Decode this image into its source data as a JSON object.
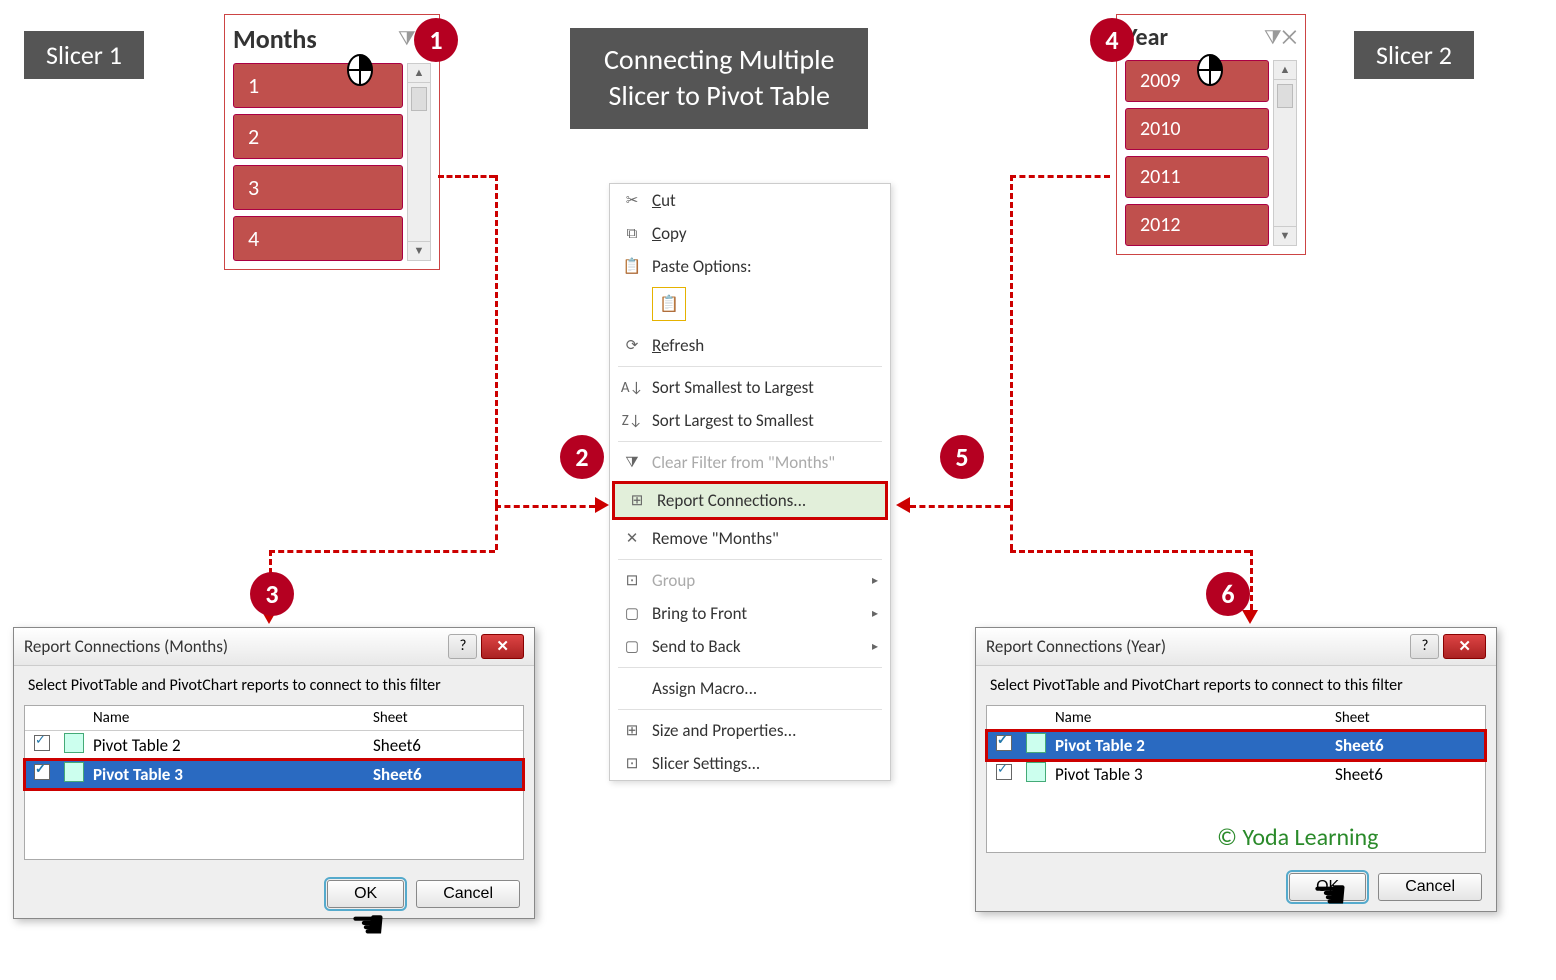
{
  "labels": {
    "slicer1": "Slicer 1",
    "slicer2": "Slicer 2"
  },
  "title_line1": "Connecting Multiple",
  "title_line2": "Slicer to Pivot Table",
  "slicer_months": {
    "title": "Months",
    "items": [
      "1",
      "2",
      "3",
      "4"
    ]
  },
  "slicer_year": {
    "title": "Year",
    "items": [
      "2009",
      "2010",
      "2011",
      "2012"
    ]
  },
  "ctx": {
    "cut": "Cut",
    "copy": "Copy",
    "paste": "Paste Options:",
    "refresh": "Refresh",
    "sort_asc": "Sort Smallest to Largest",
    "sort_desc": "Sort Largest to Smallest",
    "clear": "Clear Filter from \"Months\"",
    "report": "Report Connections...",
    "remove": "Remove \"Months\"",
    "group": "Group",
    "front": "Bring to Front",
    "back": "Send to Back",
    "macro": "Assign Macro...",
    "size": "Size and Properties...",
    "settings": "Slicer Settings..."
  },
  "dlg1": {
    "title": "Report Connections (Months)",
    "instr": "Select PivotTable and PivotChart reports to connect to this filter",
    "col_name": "Name",
    "col_sheet": "Sheet",
    "rows": [
      {
        "name": "Pivot Table 2",
        "sheet": "Sheet6",
        "sel": false
      },
      {
        "name": "Pivot Table 3",
        "sheet": "Sheet6",
        "sel": true
      }
    ],
    "ok": "OK",
    "cancel": "Cancel"
  },
  "dlg2": {
    "title": "Report Connections (Year)",
    "instr": "Select PivotTable and PivotChart reports to connect to this filter",
    "col_name": "Name",
    "col_sheet": "Sheet",
    "rows": [
      {
        "name": "Pivot Table 2",
        "sheet": "Sheet6",
        "sel": true
      },
      {
        "name": "Pivot Table 3",
        "sheet": "Sheet6",
        "sel": false
      }
    ],
    "ok": "OK",
    "cancel": "Cancel"
  },
  "badges": {
    "b1": "1",
    "b2": "2",
    "b3": "3",
    "b4": "4",
    "b5": "5",
    "b6": "6"
  },
  "credit": "© Yoda Learning"
}
